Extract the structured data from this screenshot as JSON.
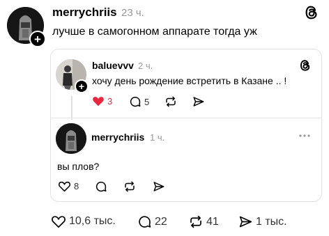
{
  "post": {
    "username": "merrychriis",
    "time": "23 ч.",
    "text": "лучше в самогонном аппарате тогда уж"
  },
  "quoted": {
    "username": "baluevvv",
    "time": "2 ч.",
    "text": "хочу день рождение встретить в Казане .. !",
    "likes": "3",
    "comments": "5",
    "like_color": "#e8283f"
  },
  "reply": {
    "username": "merrychriis",
    "time": "1 ч.",
    "text": "вы плов?",
    "likes": "8"
  },
  "bottom": {
    "likes": "10,6 тыс.",
    "comments": "22",
    "reposts": "41",
    "shares": "1 тыс."
  }
}
